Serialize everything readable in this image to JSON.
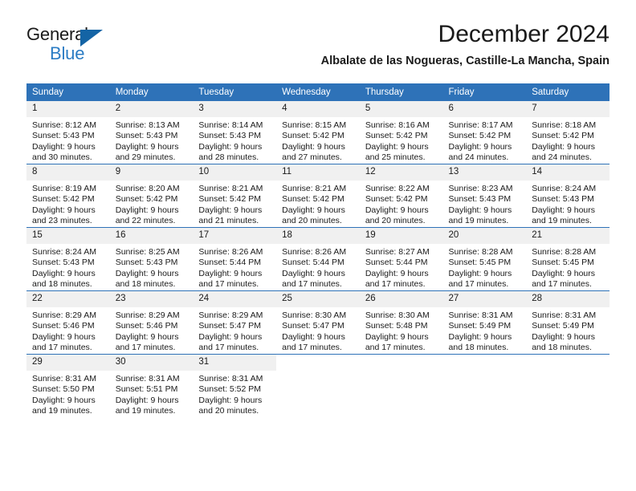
{
  "brand": {
    "name_part1": "General",
    "name_part2": "Blue",
    "logo_icon": "triangle-logo-icon"
  },
  "header": {
    "month_title": "December 2024",
    "location": "Albalate de las Nogueras, Castille-La Mancha, Spain"
  },
  "calendar": {
    "weekday_headers": [
      "Sunday",
      "Monday",
      "Tuesday",
      "Wednesday",
      "Thursday",
      "Friday",
      "Saturday"
    ],
    "weeks": [
      [
        {
          "day": "1",
          "sunrise": "Sunrise: 8:12 AM",
          "sunset": "Sunset: 5:43 PM",
          "daylight_line1": "Daylight: 9 hours",
          "daylight_line2": "and 30 minutes."
        },
        {
          "day": "2",
          "sunrise": "Sunrise: 8:13 AM",
          "sunset": "Sunset: 5:43 PM",
          "daylight_line1": "Daylight: 9 hours",
          "daylight_line2": "and 29 minutes."
        },
        {
          "day": "3",
          "sunrise": "Sunrise: 8:14 AM",
          "sunset": "Sunset: 5:43 PM",
          "daylight_line1": "Daylight: 9 hours",
          "daylight_line2": "and 28 minutes."
        },
        {
          "day": "4",
          "sunrise": "Sunrise: 8:15 AM",
          "sunset": "Sunset: 5:42 PM",
          "daylight_line1": "Daylight: 9 hours",
          "daylight_line2": "and 27 minutes."
        },
        {
          "day": "5",
          "sunrise": "Sunrise: 8:16 AM",
          "sunset": "Sunset: 5:42 PM",
          "daylight_line1": "Daylight: 9 hours",
          "daylight_line2": "and 25 minutes."
        },
        {
          "day": "6",
          "sunrise": "Sunrise: 8:17 AM",
          "sunset": "Sunset: 5:42 PM",
          "daylight_line1": "Daylight: 9 hours",
          "daylight_line2": "and 24 minutes."
        },
        {
          "day": "7",
          "sunrise": "Sunrise: 8:18 AM",
          "sunset": "Sunset: 5:42 PM",
          "daylight_line1": "Daylight: 9 hours",
          "daylight_line2": "and 24 minutes."
        }
      ],
      [
        {
          "day": "8",
          "sunrise": "Sunrise: 8:19 AM",
          "sunset": "Sunset: 5:42 PM",
          "daylight_line1": "Daylight: 9 hours",
          "daylight_line2": "and 23 minutes."
        },
        {
          "day": "9",
          "sunrise": "Sunrise: 8:20 AM",
          "sunset": "Sunset: 5:42 PM",
          "daylight_line1": "Daylight: 9 hours",
          "daylight_line2": "and 22 minutes."
        },
        {
          "day": "10",
          "sunrise": "Sunrise: 8:21 AM",
          "sunset": "Sunset: 5:42 PM",
          "daylight_line1": "Daylight: 9 hours",
          "daylight_line2": "and 21 minutes."
        },
        {
          "day": "11",
          "sunrise": "Sunrise: 8:21 AM",
          "sunset": "Sunset: 5:42 PM",
          "daylight_line1": "Daylight: 9 hours",
          "daylight_line2": "and 20 minutes."
        },
        {
          "day": "12",
          "sunrise": "Sunrise: 8:22 AM",
          "sunset": "Sunset: 5:42 PM",
          "daylight_line1": "Daylight: 9 hours",
          "daylight_line2": "and 20 minutes."
        },
        {
          "day": "13",
          "sunrise": "Sunrise: 8:23 AM",
          "sunset": "Sunset: 5:43 PM",
          "daylight_line1": "Daylight: 9 hours",
          "daylight_line2": "and 19 minutes."
        },
        {
          "day": "14",
          "sunrise": "Sunrise: 8:24 AM",
          "sunset": "Sunset: 5:43 PM",
          "daylight_line1": "Daylight: 9 hours",
          "daylight_line2": "and 19 minutes."
        }
      ],
      [
        {
          "day": "15",
          "sunrise": "Sunrise: 8:24 AM",
          "sunset": "Sunset: 5:43 PM",
          "daylight_line1": "Daylight: 9 hours",
          "daylight_line2": "and 18 minutes."
        },
        {
          "day": "16",
          "sunrise": "Sunrise: 8:25 AM",
          "sunset": "Sunset: 5:43 PM",
          "daylight_line1": "Daylight: 9 hours",
          "daylight_line2": "and 18 minutes."
        },
        {
          "day": "17",
          "sunrise": "Sunrise: 8:26 AM",
          "sunset": "Sunset: 5:44 PM",
          "daylight_line1": "Daylight: 9 hours",
          "daylight_line2": "and 17 minutes."
        },
        {
          "day": "18",
          "sunrise": "Sunrise: 8:26 AM",
          "sunset": "Sunset: 5:44 PM",
          "daylight_line1": "Daylight: 9 hours",
          "daylight_line2": "and 17 minutes."
        },
        {
          "day": "19",
          "sunrise": "Sunrise: 8:27 AM",
          "sunset": "Sunset: 5:44 PM",
          "daylight_line1": "Daylight: 9 hours",
          "daylight_line2": "and 17 minutes."
        },
        {
          "day": "20",
          "sunrise": "Sunrise: 8:28 AM",
          "sunset": "Sunset: 5:45 PM",
          "daylight_line1": "Daylight: 9 hours",
          "daylight_line2": "and 17 minutes."
        },
        {
          "day": "21",
          "sunrise": "Sunrise: 8:28 AM",
          "sunset": "Sunset: 5:45 PM",
          "daylight_line1": "Daylight: 9 hours",
          "daylight_line2": "and 17 minutes."
        }
      ],
      [
        {
          "day": "22",
          "sunrise": "Sunrise: 8:29 AM",
          "sunset": "Sunset: 5:46 PM",
          "daylight_line1": "Daylight: 9 hours",
          "daylight_line2": "and 17 minutes."
        },
        {
          "day": "23",
          "sunrise": "Sunrise: 8:29 AM",
          "sunset": "Sunset: 5:46 PM",
          "daylight_line1": "Daylight: 9 hours",
          "daylight_line2": "and 17 minutes."
        },
        {
          "day": "24",
          "sunrise": "Sunrise: 8:29 AM",
          "sunset": "Sunset: 5:47 PM",
          "daylight_line1": "Daylight: 9 hours",
          "daylight_line2": "and 17 minutes."
        },
        {
          "day": "25",
          "sunrise": "Sunrise: 8:30 AM",
          "sunset": "Sunset: 5:47 PM",
          "daylight_line1": "Daylight: 9 hours",
          "daylight_line2": "and 17 minutes."
        },
        {
          "day": "26",
          "sunrise": "Sunrise: 8:30 AM",
          "sunset": "Sunset: 5:48 PM",
          "daylight_line1": "Daylight: 9 hours",
          "daylight_line2": "and 17 minutes."
        },
        {
          "day": "27",
          "sunrise": "Sunrise: 8:31 AM",
          "sunset": "Sunset: 5:49 PM",
          "daylight_line1": "Daylight: 9 hours",
          "daylight_line2": "and 18 minutes."
        },
        {
          "day": "28",
          "sunrise": "Sunrise: 8:31 AM",
          "sunset": "Sunset: 5:49 PM",
          "daylight_line1": "Daylight: 9 hours",
          "daylight_line2": "and 18 minutes."
        }
      ],
      [
        {
          "day": "29",
          "sunrise": "Sunrise: 8:31 AM",
          "sunset": "Sunset: 5:50 PM",
          "daylight_line1": "Daylight: 9 hours",
          "daylight_line2": "and 19 minutes."
        },
        {
          "day": "30",
          "sunrise": "Sunrise: 8:31 AM",
          "sunset": "Sunset: 5:51 PM",
          "daylight_line1": "Daylight: 9 hours",
          "daylight_line2": "and 19 minutes."
        },
        {
          "day": "31",
          "sunrise": "Sunrise: 8:31 AM",
          "sunset": "Sunset: 5:52 PM",
          "daylight_line1": "Daylight: 9 hours",
          "daylight_line2": "and 20 minutes."
        },
        {
          "day": "",
          "sunrise": "",
          "sunset": "",
          "daylight_line1": "",
          "daylight_line2": ""
        },
        {
          "day": "",
          "sunrise": "",
          "sunset": "",
          "daylight_line1": "",
          "daylight_line2": ""
        },
        {
          "day": "",
          "sunrise": "",
          "sunset": "",
          "daylight_line1": "",
          "daylight_line2": ""
        },
        {
          "day": "",
          "sunrise": "",
          "sunset": "",
          "daylight_line1": "",
          "daylight_line2": ""
        }
      ]
    ]
  },
  "colors": {
    "header_blue": "#2e72b8",
    "brand_blue": "#2b7cc4",
    "logo_blue": "#1464a5",
    "daynum_bg": "#f0f0f0"
  }
}
